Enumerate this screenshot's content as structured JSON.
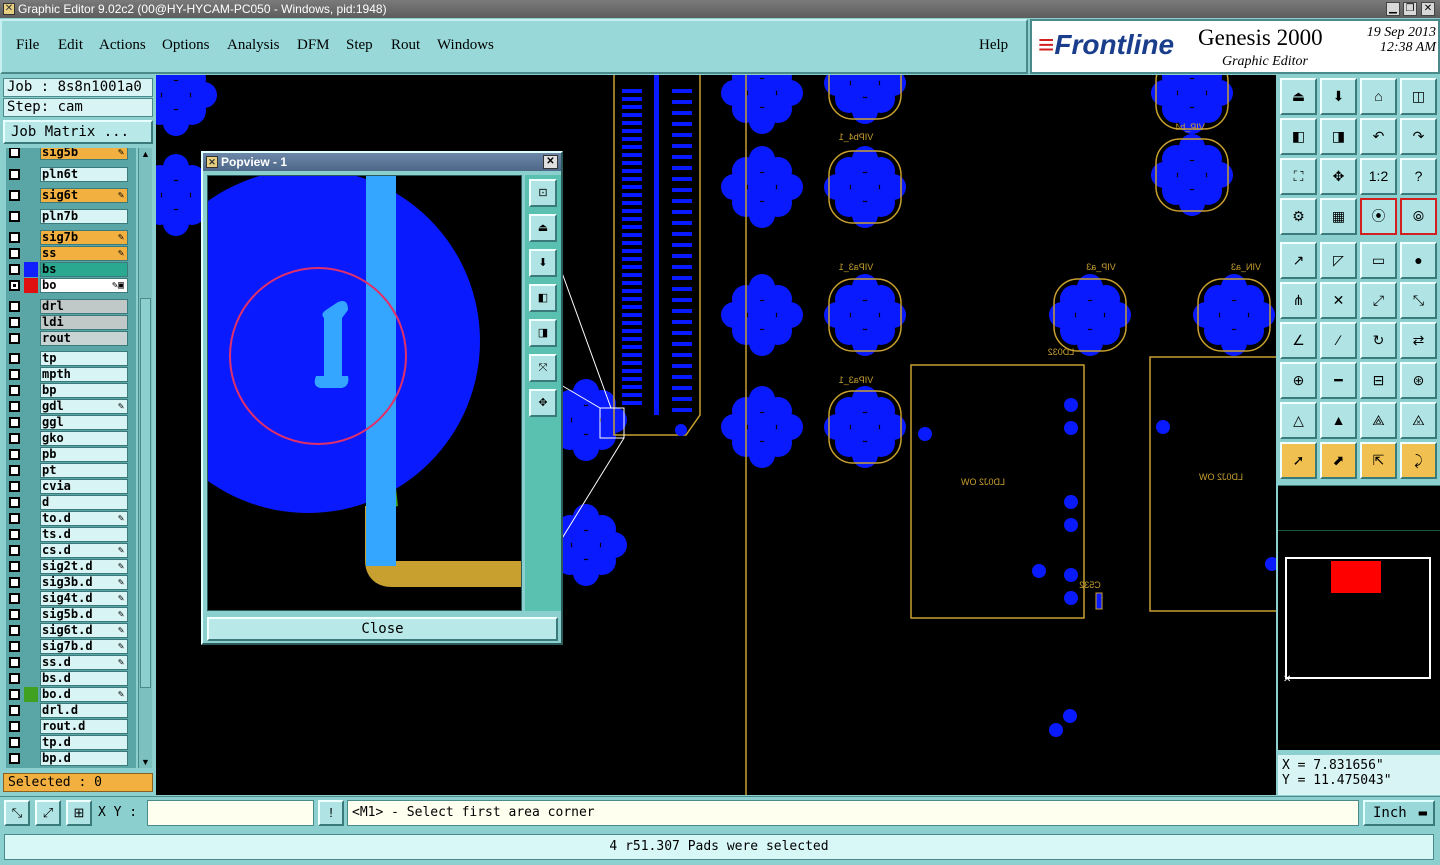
{
  "window": {
    "title": "Graphic Editor 9.02c2 (00@HY-HYCAM-PC050 - Windows, pid:1948)"
  },
  "menu": [
    "File",
    "Edit",
    "Actions",
    "Options",
    "Analysis",
    "DFM",
    "Step",
    "Rout",
    "Windows"
  ],
  "help": "Help",
  "brand": {
    "logo": "Frontline",
    "product": "Genesis 2000",
    "subtitle": "Graphic Editor",
    "date": "19 Sep 2013",
    "time": "12:38 AM"
  },
  "job": {
    "name": "Job : 8s8n1001a0",
    "step": "Step: cam",
    "matrix_button": "Job Matrix ..."
  },
  "layers": [
    {
      "name": "sig5b",
      "color": "#f2b040",
      "mark": "✎"
    },
    {
      "name": "pln6t",
      "color": "#d8f4f4",
      "mark": ""
    },
    {
      "name": "sig6t",
      "color": "#f2b040",
      "mark": "✎"
    },
    {
      "name": "pln7b",
      "color": "#d8f4f4",
      "mark": ""
    },
    {
      "name": "sig7b",
      "color": "#f2b040",
      "mark": "✎"
    },
    {
      "name": "ss",
      "color": "#f2b040",
      "mark": "✎"
    },
    {
      "name": "bs",
      "color": "#2aa890",
      "mark": "",
      "swatch": "#1020ff"
    },
    {
      "name": "bo",
      "color": "#ffffff",
      "mark": "✎▣",
      "swatch": "#e01010",
      "active": true
    },
    {
      "name": "drl",
      "color": "#c0c8c8",
      "mark": ""
    },
    {
      "name": "ldi",
      "color": "#c0c8c8",
      "mark": ""
    },
    {
      "name": "rout",
      "color": "#c8d4d4",
      "mark": ""
    },
    {
      "name": "tp",
      "color": "#d8f4f4",
      "mark": ""
    },
    {
      "name": "mpth",
      "color": "#d8f4f4",
      "mark": ""
    },
    {
      "name": "bp",
      "color": "#d8f4f4",
      "mark": ""
    },
    {
      "name": "gdl",
      "color": "#d8f4f4",
      "mark": "✎"
    },
    {
      "name": "ggl",
      "color": "#d8f4f4",
      "mark": ""
    },
    {
      "name": "gko",
      "color": "#d8f4f4",
      "mark": ""
    },
    {
      "name": "pb",
      "color": "#d8f4f4",
      "mark": ""
    },
    {
      "name": "pt",
      "color": "#d8f4f4",
      "mark": ""
    },
    {
      "name": "cvia",
      "color": "#d8f4f4",
      "mark": ""
    },
    {
      "name": "d",
      "color": "#d8f4f4",
      "mark": ""
    },
    {
      "name": "to.d",
      "color": "#d8f4f4",
      "mark": "✎"
    },
    {
      "name": "ts.d",
      "color": "#d8f4f4",
      "mark": ""
    },
    {
      "name": "cs.d",
      "color": "#d8f4f4",
      "mark": "✎"
    },
    {
      "name": "sig2t.d",
      "color": "#d8f4f4",
      "mark": "✎"
    },
    {
      "name": "sig3b.d",
      "color": "#d8f4f4",
      "mark": "✎"
    },
    {
      "name": "sig4t.d",
      "color": "#d8f4f4",
      "mark": "✎"
    },
    {
      "name": "sig5b.d",
      "color": "#d8f4f4",
      "mark": "✎"
    },
    {
      "name": "sig6t.d",
      "color": "#d8f4f4",
      "mark": "✎"
    },
    {
      "name": "sig7b.d",
      "color": "#d8f4f4",
      "mark": "✎"
    },
    {
      "name": "ss.d",
      "color": "#d8f4f4",
      "mark": "✎"
    },
    {
      "name": "bs.d",
      "color": "#d8f4f4",
      "mark": ""
    },
    {
      "name": "bo.d",
      "color": "#d8f4f4",
      "mark": "✎",
      "swatch": "#40a020"
    },
    {
      "name": "drl.d",
      "color": "#d8f4f4",
      "mark": ""
    },
    {
      "name": "rout.d",
      "color": "#d8f4f4",
      "mark": ""
    },
    {
      "name": "tp.d",
      "color": "#d8f4f4",
      "mark": ""
    },
    {
      "name": "bp.d",
      "color": "#d8f4f4",
      "mark": ""
    }
  ],
  "selected": "Selected : 0",
  "popview": {
    "title": "Popview - 1",
    "close": "Close",
    "tool_icons": [
      "zoom-window-icon",
      "zoom-in-icon",
      "zoom-out-icon",
      "pan-left-icon",
      "pan-right-icon",
      "fit-all-icon",
      "center-icon"
    ]
  },
  "canvas_labels": [
    "VIPb4_1",
    "VIPa3_1",
    "VIPa3_1",
    "VIP_a3",
    "VIN_a3",
    "VIP_b4",
    "LD032",
    "LD0J2 OW",
    "LD0J2 OW",
    "C532"
  ],
  "toolbar_icons": [
    "home-up-icon",
    "home-down-icon",
    "home-icon",
    "split-view-icon",
    "home-left-icon",
    "home-right-icon",
    "undo-view-icon",
    "redo-view-icon",
    "zoom-fit-icon",
    "zoom-center-icon",
    "ratio-1-2-icon",
    "help-icon",
    "settings-icon",
    "grid-icon",
    "layer-display-icon",
    "layer-display-alt-icon",
    "measure-icon",
    "draw-icon",
    "ruler-icon",
    "select-pad-icon",
    "net-icon",
    "cross-icon",
    "connect-icon",
    "connect-alt-icon",
    "line-icon",
    "line-alt-icon",
    "arc-icon",
    "flip-icon",
    "pad-add-icon",
    "line-cut-icon",
    "gap-icon",
    "feature-icon",
    "triangle-icon",
    "triangle-alt-icon",
    "triangle-select-icon",
    "triangle-cross-icon",
    "pointer-icon",
    "pointer-box-icon",
    "pointer-alt-icon",
    "route-icon"
  ],
  "toolbar_labels": {
    "ratio": "1:2",
    "help": "?"
  },
  "coords": {
    "x": "X = 7.831656\"",
    "y": "Y = 11.475043\""
  },
  "cmd": {
    "xy_label": "X Y :",
    "xy_value": "",
    "prompt": "<M1> - Select first area corner",
    "unit": "Inch",
    "warn": "!"
  },
  "status": "4 r51.307 Pads were selected",
  "colors": {
    "pad": "#0a1aff",
    "outline": "#c8a030",
    "panel": "#8ccfcf"
  }
}
